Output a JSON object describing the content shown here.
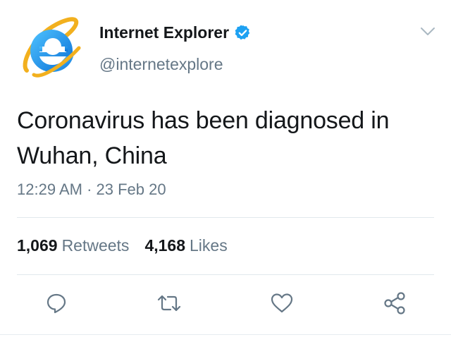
{
  "user": {
    "display_name": "Internet Explorer",
    "handle": "@internetexplore",
    "verified": true,
    "avatar_icon": "internet-explorer-logo-icon"
  },
  "tweet": {
    "text": "Coronavirus has been diagnosed in Wuhan, China",
    "timestamp": "12:29 AM · 23 Feb 20"
  },
  "stats": {
    "retweets_count": "1,069",
    "retweets_label": "Retweets",
    "likes_count": "4,168",
    "likes_label": "Likes"
  },
  "actions": [
    {
      "icon": "reply-icon"
    },
    {
      "icon": "retweet-icon"
    },
    {
      "icon": "like-icon"
    },
    {
      "icon": "share-icon"
    }
  ],
  "colors": {
    "text_primary": "#14171a",
    "text_secondary": "#657786",
    "verified_blue": "#1da1f2",
    "divider": "#e1e8ed",
    "ie_blue": "#1e90ff",
    "ie_gold": "#f2b01e"
  }
}
